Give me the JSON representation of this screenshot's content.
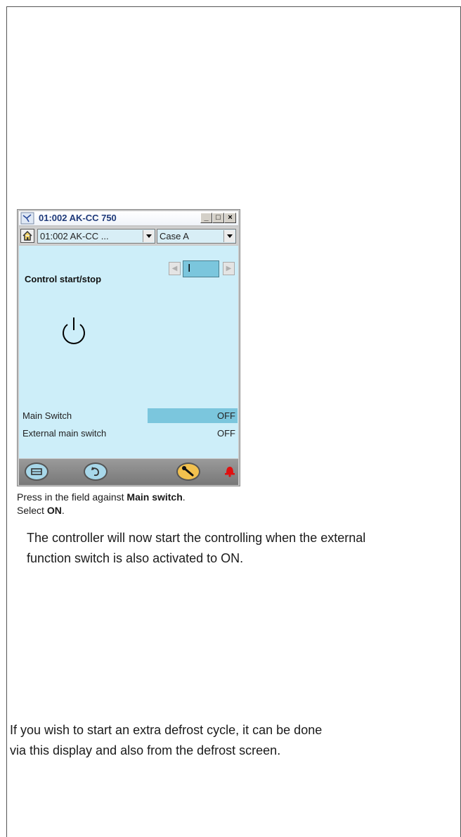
{
  "window": {
    "title": "01:002 AK-CC 750",
    "controller_combo": "01:002 AK-CC ...",
    "section_combo": "Case A",
    "min_btn": "_",
    "max_btn": "□",
    "close_btn": "×"
  },
  "screen": {
    "heading": "Control start/stop",
    "onoff_value": "I",
    "rows": [
      {
        "label": "Main Switch",
        "value": "OFF"
      },
      {
        "label": "External main switch",
        "value": "OFF"
      }
    ]
  },
  "instructions": {
    "line1_prefix": "Press in the field against ",
    "line1_bold": "Main switch",
    "line1_suffix": ".",
    "line2_prefix": "Select ",
    "line2_bold": "ON",
    "line2_suffix": "."
  },
  "paragraphs": {
    "p1_line1": "The controller will now start the controlling when the external",
    "p1_line2": "function switch is also activated to ON.",
    "p2_line1": "If you wish to start an extra defrost cycle, it can be done",
    "p2_line2": "via this display and also from the defrost screen."
  }
}
